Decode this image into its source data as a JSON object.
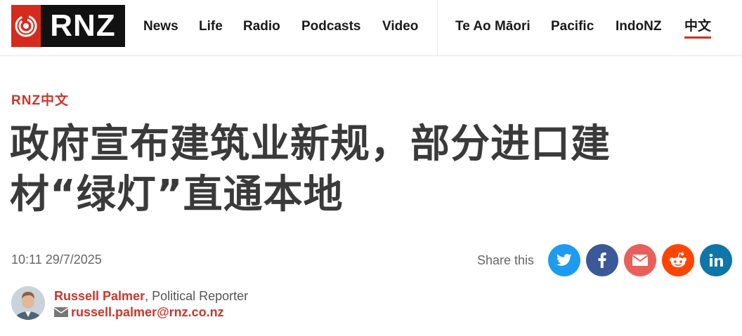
{
  "header": {
    "logo_text": "RNZ",
    "nav": [
      {
        "label": "News"
      },
      {
        "label": "Life"
      },
      {
        "label": "Radio"
      },
      {
        "label": "Podcasts"
      },
      {
        "label": "Video"
      },
      {
        "label": "Te Ao Māori"
      },
      {
        "label": "Pacific"
      },
      {
        "label": "IndoNZ"
      },
      {
        "label": "中文",
        "active": true
      }
    ]
  },
  "article": {
    "kicker": "RNZ中文",
    "headline_line1": "政府宣布建筑业新规，部分进口建",
    "headline_line2": "材“绿灯”直通本地",
    "timestamp": "10:11 29/7/2025",
    "share_label": "Share this",
    "share_buttons": [
      {
        "icon": "twitter-icon",
        "color": "#1d9bf0"
      },
      {
        "icon": "facebook-icon",
        "color": "#3b5998"
      },
      {
        "icon": "email-icon",
        "color": "#e9605a"
      },
      {
        "icon": "reddit-icon",
        "color": "#ff4500"
      },
      {
        "icon": "linkedin-icon",
        "color": "#0e76a8"
      }
    ],
    "author": {
      "name": "Russell Palmer",
      "role": ", Political Reporter",
      "email": "russell.palmer@rnz.co.nz"
    }
  },
  "colors": {
    "brand_red": "#d52b1e",
    "accent_red": "#c8372d",
    "headline": "#3a3a3a"
  }
}
